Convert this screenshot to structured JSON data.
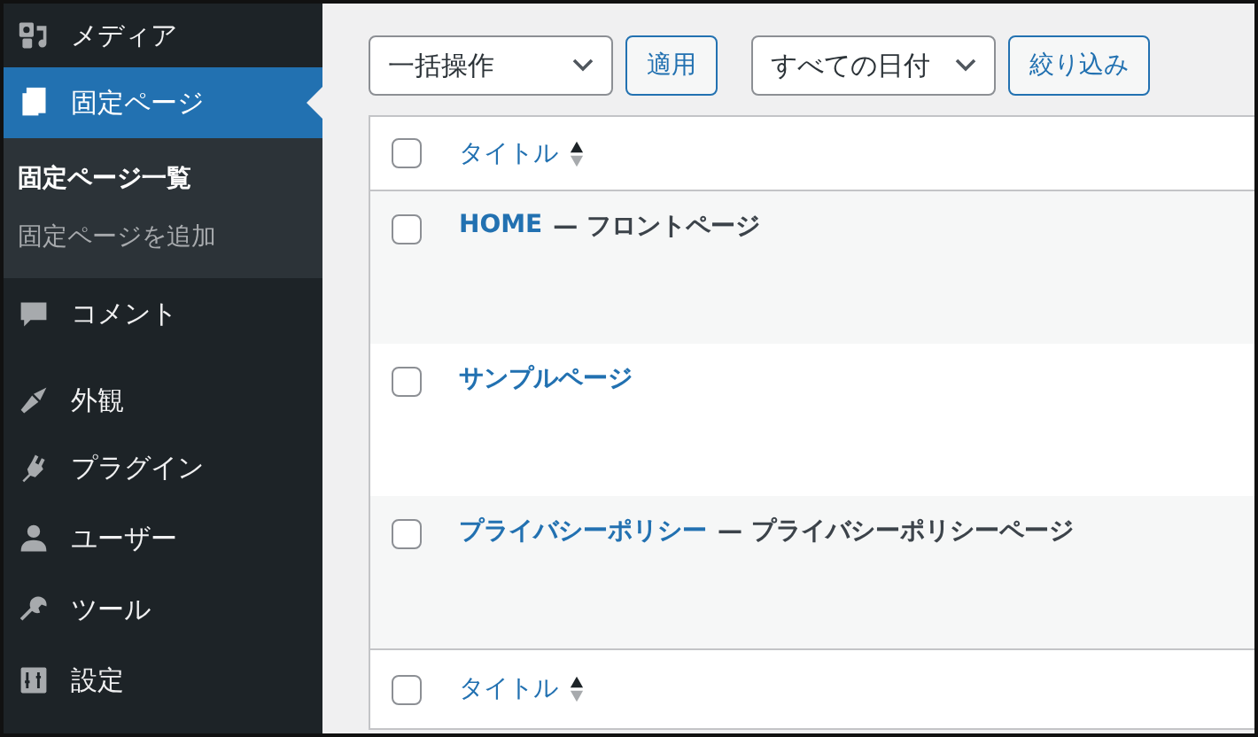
{
  "sidebar": {
    "groups": [
      [
        {
          "label": "メディア",
          "selected": false
        },
        {
          "label": "固定ページ",
          "selected": true,
          "submenu": [
            {
              "label": "固定ページ一覧",
              "selected": true
            },
            {
              "label": "固定ページを追加",
              "selected": false
            }
          ]
        },
        {
          "label": "コメント",
          "selected": false
        }
      ],
      [
        {
          "label": "外観",
          "selected": false
        },
        {
          "label": "プラグイン",
          "selected": false
        },
        {
          "label": "ユーザー",
          "selected": false
        },
        {
          "label": "ツール",
          "selected": false
        },
        {
          "label": "設定",
          "selected": false
        }
      ]
    ]
  },
  "toolbar": {
    "bulk_action": "一括操作",
    "apply": "適用",
    "date_filter": "すべての日付",
    "filter": "絞り込み"
  },
  "table": {
    "header": {
      "checked": false,
      "column": "タイトル"
    },
    "rows": [
      {
        "checked": false,
        "title": "HOME",
        "state": "— フロントページ"
      },
      {
        "checked": false,
        "title": "サンプルページ"
      },
      {
        "checked": false,
        "title": "プライバシーポリシー",
        "state": "— プライバシーポリシーページ"
      }
    ],
    "footer": {
      "checked": false,
      "column": "タイトル"
    }
  }
}
